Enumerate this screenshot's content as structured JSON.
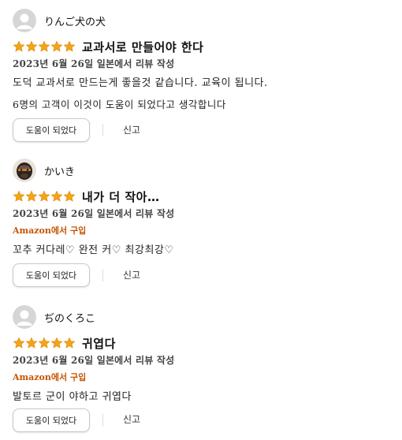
{
  "colors": {
    "star": "#f4a419",
    "star_stroke": "#de8b00",
    "badge": "#c45500",
    "avatar_bg": "#d6d6d6"
  },
  "icons": {
    "default_avatar": "person-silhouette-icon",
    "custom_avatar": "dog-photo-avatar",
    "star": "star-icon"
  },
  "reviews": [
    {
      "username": "りんご犬の犬",
      "avatar": "default",
      "rating": 5,
      "title": "교과서로 만들어야 한다",
      "date": "2023년 6월 26일 일본에서 리뷰 작성",
      "badge": "",
      "body": [
        "도덕 교과서로 만드는게 좋을것 같습니다. 교육이 됩니다.",
        "6명의 고객이 이것이 도움이 되었다고 생각합니다"
      ],
      "helpful_label": "도움이 되었다",
      "report_label": "신고"
    },
    {
      "username": "かいき",
      "avatar": "photo",
      "rating": 5,
      "title": "내가 더 작아…",
      "date": "2023년 6월 26일 일본에서 리뷰 작성",
      "badge": "Amazon에서 구입",
      "body": [
        "꼬추 커다레♡ 완전 커♡ 최강최강♡"
      ],
      "helpful_label": "도움이 되었다",
      "report_label": "신고"
    },
    {
      "username": "ぢのくろこ",
      "avatar": "default",
      "rating": 5,
      "title": "귀엽다",
      "date": "2023년 6월 26일 일본에서 리뷰 작성",
      "badge": "Amazon에서 구입",
      "body": [
        "발토르 군이 야하고 귀엽다"
      ],
      "helpful_label": "도움이 되었다",
      "report_label": "신고"
    }
  ]
}
